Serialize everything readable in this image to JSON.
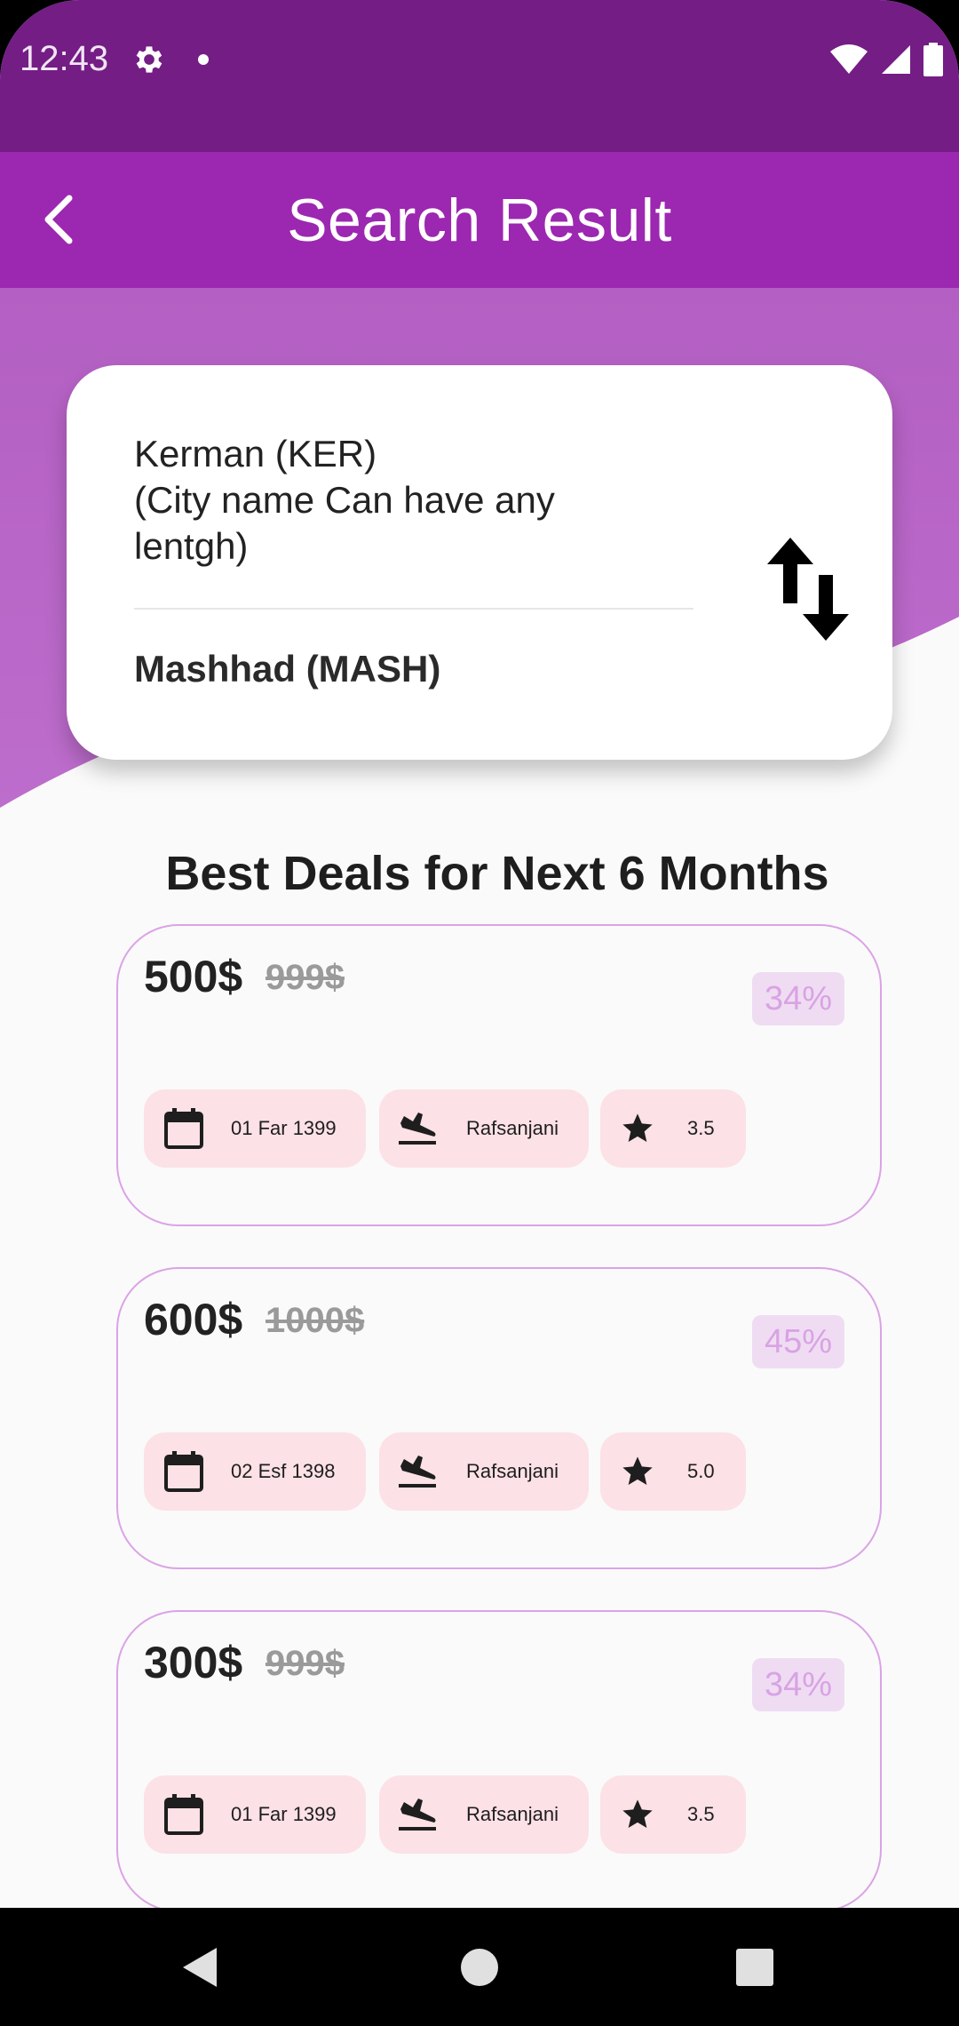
{
  "status_bar": {
    "time": "12:43",
    "icons": [
      "gear-icon",
      "notification-dot-icon",
      "wifi-icon",
      "signal-icon",
      "battery-icon"
    ]
  },
  "app_bar": {
    "title": "Search Result",
    "back_icon": "chevron-left-icon"
  },
  "route": {
    "origin": "Kerman (KER)\n (City name Can have any lentgh)",
    "destination": "Mashhad (MASH)",
    "swap_icon": "swap-vertical-icon"
  },
  "section_title": "Best Deals for Next 6 Months",
  "deals": [
    {
      "price": "500$",
      "old_price": "999$",
      "discount": "34%",
      "date": "01 Far 1399",
      "airport": "Rafsanjani",
      "rating": "3.5"
    },
    {
      "price": "600$",
      "old_price": "1000$",
      "discount": "45%",
      "date": "02 Esf 1398",
      "airport": "Rafsanjani",
      "rating": "5.0"
    },
    {
      "price": "300$",
      "old_price": "999$",
      "discount": "34%",
      "date": "01 Far 1399",
      "airport": "Rafsanjani",
      "rating": "3.5"
    }
  ],
  "chip_icons": {
    "date": "calendar-icon",
    "airport": "flight-land-icon",
    "rating": "star-icon"
  },
  "nav_bar": {
    "items": [
      "back-triangle-icon",
      "home-circle-icon",
      "recents-square-icon"
    ]
  },
  "colors": {
    "status_bar": "#741d85",
    "app_bar": "#9c27b0",
    "hero": "#ba68c8",
    "chip": "#fce1e6",
    "card_border": "#dba3e6"
  }
}
